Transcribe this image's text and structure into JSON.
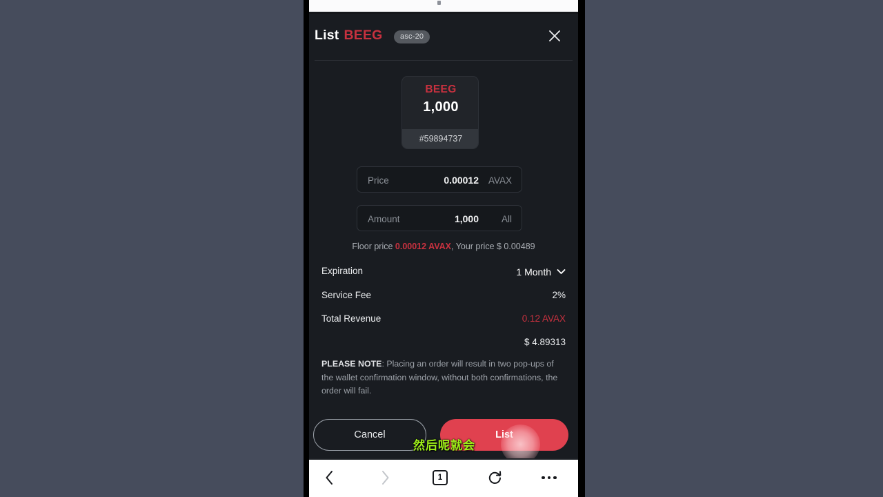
{
  "modal": {
    "title_prefix": "List",
    "ticker": "BEEG",
    "type_badge": "asc-20",
    "close_icon": "close-icon"
  },
  "token_card": {
    "symbol": "BEEG",
    "amount": "1,000",
    "inscription_id": "#59894737"
  },
  "fields": {
    "price": {
      "label": "Price",
      "value": "0.00012",
      "suffix": "AVAX"
    },
    "amount": {
      "label": "Amount",
      "value": "1,000",
      "suffix": "All"
    }
  },
  "floor_price": {
    "prefix": "Floor price ",
    "highlight": "0.00012 AVAX",
    "suffix": ", Your price $ 0.00489"
  },
  "details": {
    "expiration": {
      "label": "Expiration",
      "value": "1 Month",
      "icon": "chevron-down-icon"
    },
    "service_fee": {
      "label": "Service Fee",
      "value": "2%"
    },
    "total_revenue": {
      "label": "Total Revenue",
      "value": "0.12 AVAX"
    },
    "usd_equivalent": "$ 4.89313"
  },
  "note": {
    "heading": "PLEASE NOTE",
    "body": ": Placing an order will result in two pop-ups of the wallet confirmation window, without both confirmations, the order will fail."
  },
  "actions": {
    "cancel_label": "Cancel",
    "list_label": "List"
  },
  "overlay": {
    "subtitle": "然后呢就会"
  },
  "browser_nav": {
    "back_icon": "chevron-left-icon",
    "forward_icon": "chevron-right-icon",
    "tab_count": "1",
    "refresh_icon": "refresh-icon",
    "more_icon": "more-horizontal-icon"
  },
  "colors": {
    "backdrop": "#464c5c",
    "modal_bg": "#191c21",
    "accent_red": "#c8313f",
    "list_button": "#e0414f",
    "subtitle_green": "#9ff019"
  }
}
